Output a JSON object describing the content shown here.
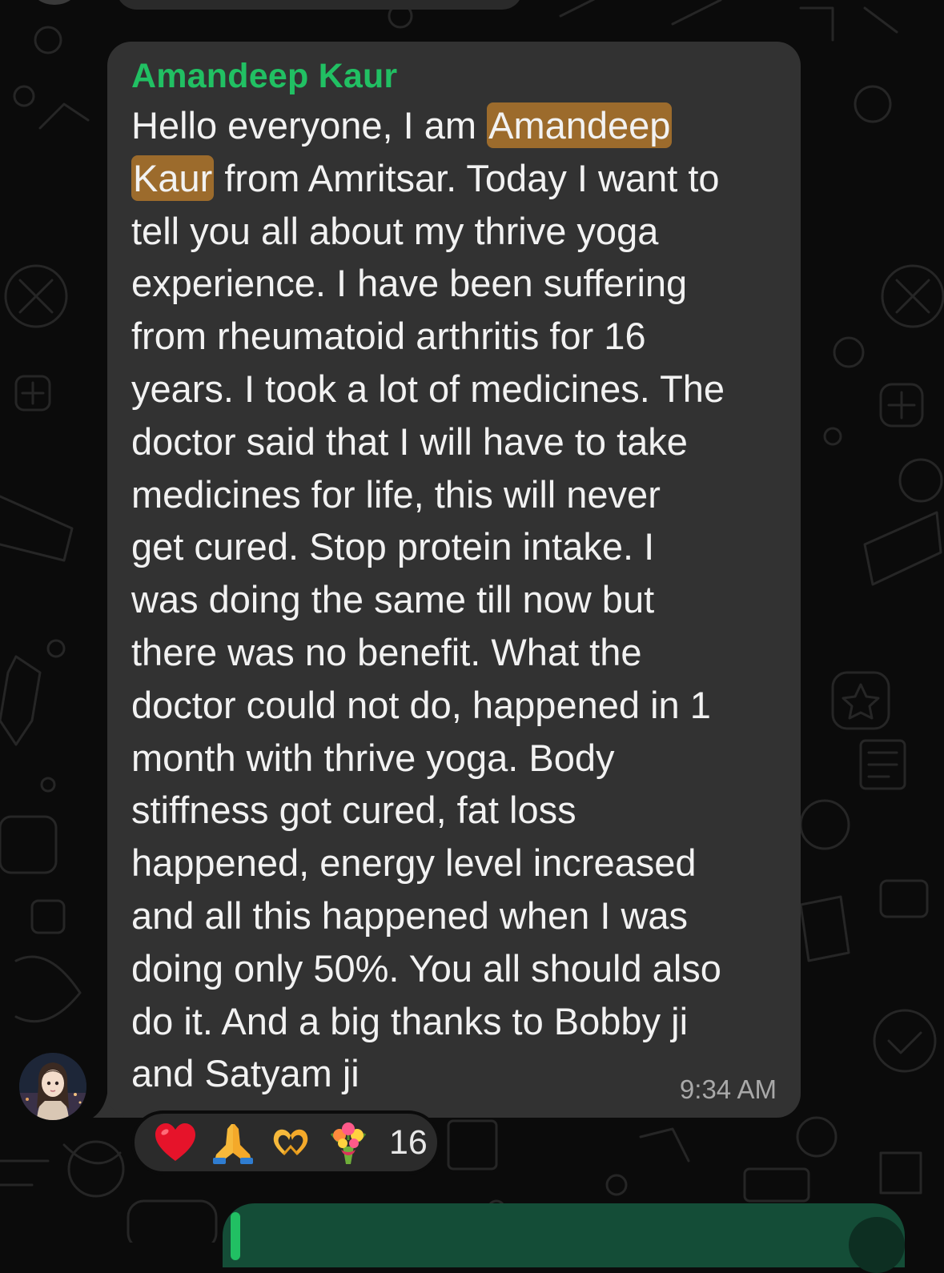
{
  "message": {
    "sender": "Amandeep Kaur",
    "lines": [
      [
        "Hello everyone, I am ",
        "Amandeep",
        ""
      ],
      [
        "",
        "Kaur",
        " from Amritsar. Today I want to"
      ],
      [
        "tell you all about my thrive yoga"
      ],
      [
        "experience. I have been suffering"
      ],
      [
        "from rheumatoid arthritis for 16"
      ],
      [
        "years. I took a lot of medicines. The"
      ],
      [
        "doctor said that I will have to take"
      ],
      [
        "medicines for life, this will never"
      ],
      [
        "get cured. Stop protein intake. I"
      ],
      [
        "was doing the same till now but"
      ],
      [
        "there was no benefit. What the"
      ],
      [
        "doctor could not do, happened in 1"
      ],
      [
        "month with thrive yoga. Body"
      ],
      [
        "stiffness got cured, fat loss"
      ],
      [
        "happened, energy level increased"
      ],
      [
        "and all this happened when I was"
      ],
      [
        "doing only 50%. You all should also"
      ],
      [
        "do it. And a big thanks to Bobby ji"
      ],
      [
        "and Satyam ji"
      ]
    ],
    "highlighted_terms": [
      "Amandeep",
      "Kaur"
    ],
    "time": "9:34 AM"
  },
  "reactions": {
    "emojis": [
      "heart-icon",
      "folded-hands-icon",
      "heart-hands-icon",
      "bouquet-icon"
    ],
    "count": "16"
  },
  "colors": {
    "background": "#0b0b0b",
    "bubble": "#323232",
    "sender": "#21c063",
    "highlight": "#9c6b2c",
    "outgoing_bubble": "#144d37"
  }
}
